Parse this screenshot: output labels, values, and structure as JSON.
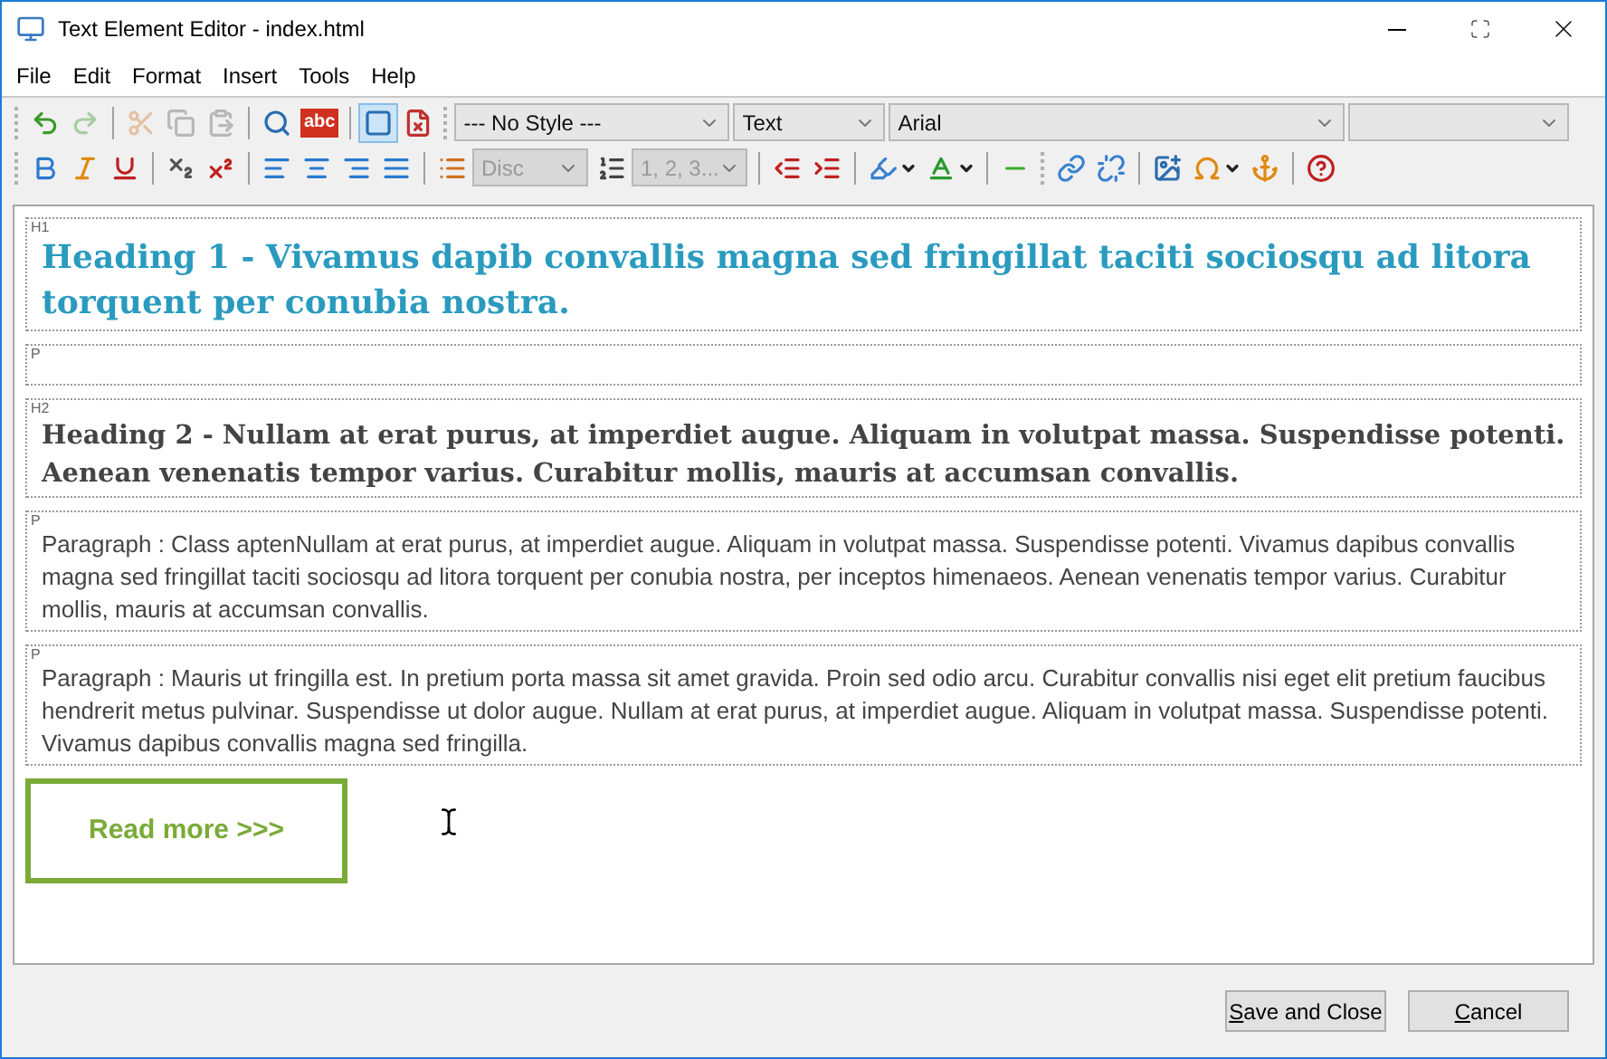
{
  "window": {
    "title": "Text Element Editor - index.html"
  },
  "menu": [
    "File",
    "Edit",
    "Format",
    "Insert",
    "Tools",
    "Help"
  ],
  "toolbar_rows": [
    [
      {
        "kind": "grip"
      },
      {
        "kind": "undo",
        "disabled": false
      },
      {
        "kind": "redo",
        "disabled": true
      },
      {
        "kind": "separator"
      },
      {
        "kind": "cut",
        "disabled": true
      },
      {
        "kind": "copy",
        "disabled": true
      },
      {
        "kind": "paste",
        "disabled": true
      },
      {
        "kind": "separator"
      },
      {
        "kind": "find",
        "disabled": false
      },
      {
        "kind": "spellcheck",
        "label": "abc",
        "disabled": false
      },
      {
        "kind": "separator"
      },
      {
        "kind": "blocks",
        "selected": true
      },
      {
        "kind": "stylesheet",
        "selected": false
      },
      {
        "kind": "grip"
      },
      {
        "kind": "style-combo",
        "value": "--- No Style ---",
        "disabled": false
      },
      {
        "kind": "block-combo",
        "value": "Text",
        "disabled": false
      },
      {
        "kind": "font-combo",
        "value": "Arial",
        "disabled": false
      },
      {
        "kind": "size-combo",
        "disabled": false
      }
    ],
    [
      {
        "kind": "grip"
      },
      {
        "kind": "bold",
        "disabled": false
      },
      {
        "kind": "italic",
        "disabled": false
      },
      {
        "kind": "underline",
        "disabled": false
      },
      {
        "kind": "separator"
      },
      {
        "kind": "subscript",
        "disabled": false
      },
      {
        "kind": "superscript",
        "disabled": false
      },
      {
        "kind": "separator"
      },
      {
        "kind": "align-left",
        "disabled": false
      },
      {
        "kind": "align-center",
        "disabled": false
      },
      {
        "kind": "align-right",
        "disabled": false
      },
      {
        "kind": "justify",
        "disabled": false
      },
      {
        "kind": "separator"
      },
      {
        "kind": "bullets",
        "disabled": false
      },
      {
        "kind": "list-combo",
        "value": "Disc",
        "disabled": true
      },
      {
        "kind": "numbering",
        "disabled": false
      },
      {
        "kind": "list-combo",
        "value": "1, 2, 3...",
        "disabled": true
      },
      {
        "kind": "separator"
      },
      {
        "kind": "outdent",
        "disabled": false
      },
      {
        "kind": "indent",
        "disabled": false
      },
      {
        "kind": "separator"
      },
      {
        "kind": "highlight",
        "disabled": false
      },
      {
        "kind": "dropdown"
      },
      {
        "kind": "font-color",
        "disabled": false
      },
      {
        "kind": "dropdown"
      },
      {
        "kind": "separator"
      },
      {
        "kind": "rule",
        "disabled": false
      },
      {
        "kind": "grip"
      },
      {
        "kind": "link",
        "disabled": false
      },
      {
        "kind": "unlink",
        "disabled": false
      },
      {
        "kind": "separator"
      },
      {
        "kind": "image",
        "disabled": false
      },
      {
        "kind": "omega",
        "disabled": false
      },
      {
        "kind": "dropdown"
      },
      {
        "kind": "anchor",
        "disabled": false
      },
      {
        "kind": "separator"
      },
      {
        "kind": "help",
        "disabled": false
      }
    ]
  ],
  "blocks": [
    {
      "kind": "heading1",
      "tag": "H1",
      "text": "Heading 1 - Vivamus dapib convallis magna sed fringillat taciti sociosqu ad litora torquent per conubia nostra."
    },
    {
      "kind": "empty",
      "tag": "P"
    },
    {
      "kind": "heading2",
      "tag": "H2",
      "text": "Heading 2 - Nullam at erat purus, at imperdiet augue. Aliquam in volutpat massa. Suspendisse potenti. Aenean venenatis tempor varius. Curabitur mollis, mauris at accumsan convallis."
    },
    {
      "kind": "paragraph",
      "tag": "P",
      "text": "Paragraph : Class aptenNullam at erat purus, at imperdiet augue. Aliquam in volutpat massa. Suspendisse potenti. Vivamus dapibus convallis magna sed fringillat taciti sociosqu ad litora torquent per conubia nostra, per inceptos himenaeos. Aenean venenatis tempor varius. Curabitur mollis, mauris at accumsan convallis."
    },
    {
      "kind": "paragraph",
      "tag": "P",
      "text": "Paragraph : Mauris ut fringilla est. In pretium porta massa sit amet gravida. Proin sed odio arcu. Curabitur convallis nisi eget elit pretium faucibus hendrerit metus pulvinar. Suspendisse ut dolor augue. Nullam at erat purus, at imperdiet augue. Aliquam in volutpat massa. Suspendisse potenti. Vivamus dapibus convallis magna sed fringilla."
    },
    {
      "kind": "button",
      "text": "Read more >>>"
    }
  ],
  "buttons": [
    {
      "mnemonic": "S",
      "rest": "ave and Close"
    },
    {
      "mnemonic": "C",
      "rest": "ancel"
    }
  ]
}
